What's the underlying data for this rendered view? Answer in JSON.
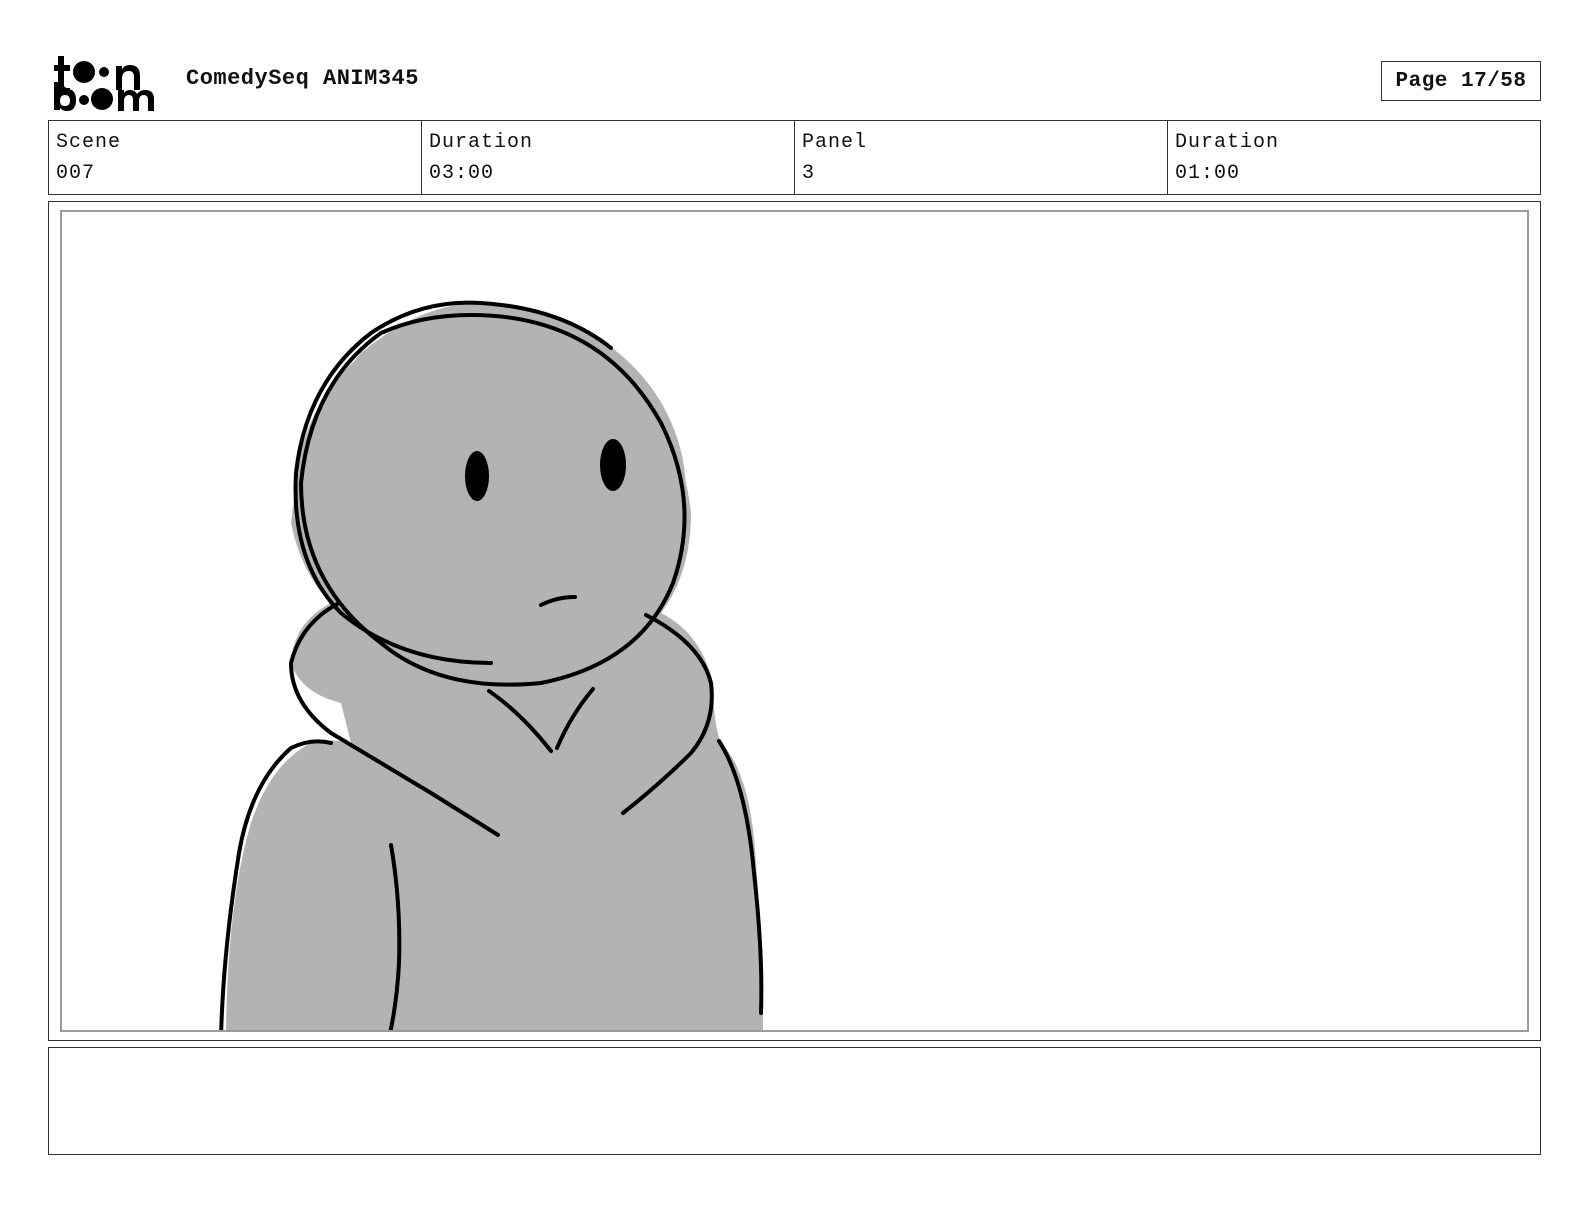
{
  "header": {
    "project_title": "ComedySeq ANIM345",
    "page_label": "Page 17/58"
  },
  "logo": {
    "icon": "toon-boom-logo-icon",
    "text_top": "toon",
    "text_bottom": "boom"
  },
  "info": [
    {
      "label": "Scene",
      "value": "007"
    },
    {
      "label": "Duration",
      "value": "03:00"
    },
    {
      "label": "Panel",
      "value": "3"
    },
    {
      "label": "Duration",
      "value": "01:00"
    }
  ],
  "panel": {
    "drawing": "character-sketch",
    "fill_color": "#b3b3b3",
    "line_color": "#000000"
  },
  "caption": {
    "text": ""
  }
}
